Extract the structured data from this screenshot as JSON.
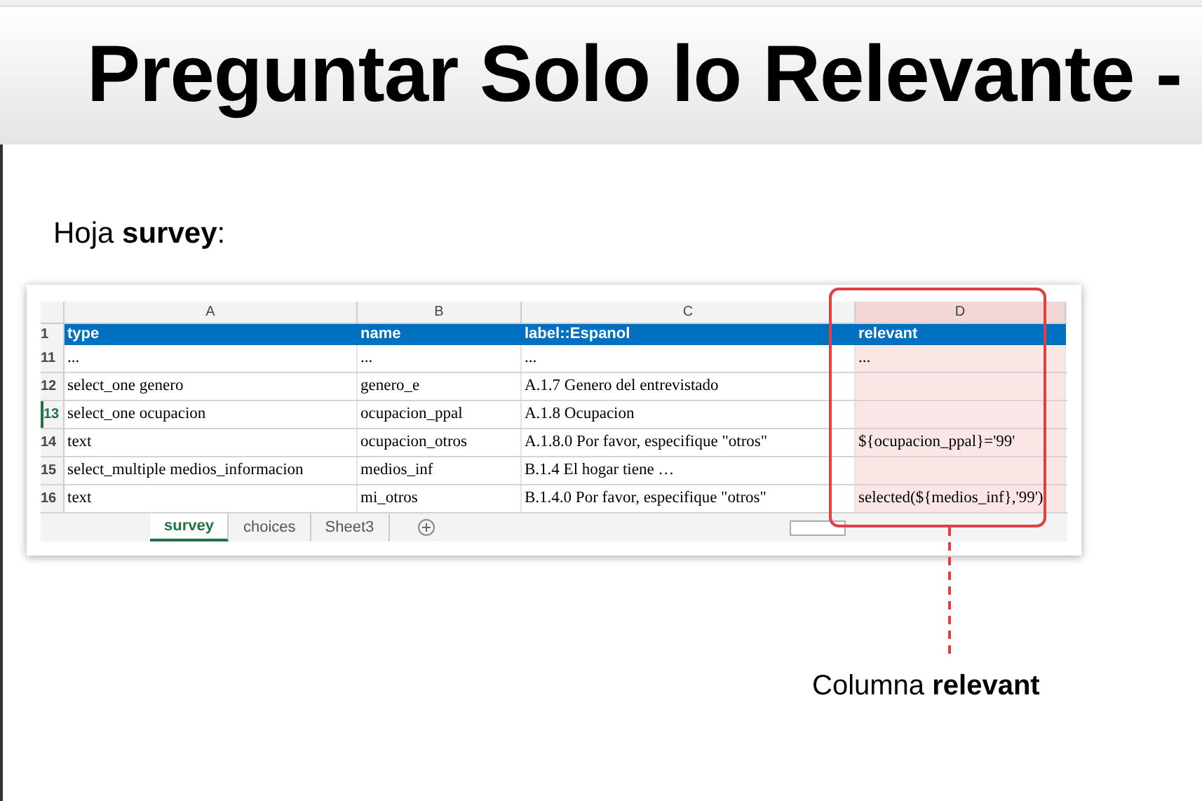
{
  "slide": {
    "title": "Preguntar Solo lo Relevante -",
    "subtitle": "Hoja **survey**:",
    "spreadsheet": {
      "columns": [
        "A",
        "B",
        "C",
        "D"
      ],
      "rows": [
        {
          "number": "1",
          "kind": "header",
          "selected": false,
          "cells": [
            "type",
            "name",
            "label::Espanol",
            "relevant"
          ]
        },
        {
          "number": "11",
          "kind": "data",
          "selected": false,
          "cells": [
            "...",
            "...",
            "...",
            "..."
          ]
        },
        {
          "number": "12",
          "kind": "data",
          "selected": false,
          "cells": [
            "select_one genero",
            "genero_e",
            "A.1.7 Genero del entrevistado",
            ""
          ]
        },
        {
          "number": "13",
          "kind": "data",
          "selected": true,
          "cells": [
            "select_one ocupacion",
            "ocupacion_ppal",
            "A.1.8 Ocupacion",
            ""
          ]
        },
        {
          "number": "14",
          "kind": "data",
          "selected": false,
          "cells": [
            "text",
            "ocupacion_otros",
            "A.1.8.0 Por favor, especifique \"otros\"",
            "${ocupacion_ppal}='99'"
          ]
        },
        {
          "number": "15",
          "kind": "data",
          "selected": false,
          "cells": [
            "select_multiple medios_informacion",
            "medios_inf",
            "B.1.4 El hogar tiene …",
            ""
          ]
        },
        {
          "number": "16",
          "kind": "data",
          "selected": false,
          "cells": [
            "text",
            "mi_otros",
            "B.1.4.0 Por favor, especifique \"otros\"",
            "selected(${medios_inf},'99')"
          ]
        }
      ],
      "sheet_tabs": [
        {
          "label": "survey",
          "selected": true
        },
        {
          "label": "choices",
          "selected": false
        },
        {
          "label": "Sheet3",
          "selected": false
        }
      ]
    },
    "callout": "Columna **relevant**"
  }
}
